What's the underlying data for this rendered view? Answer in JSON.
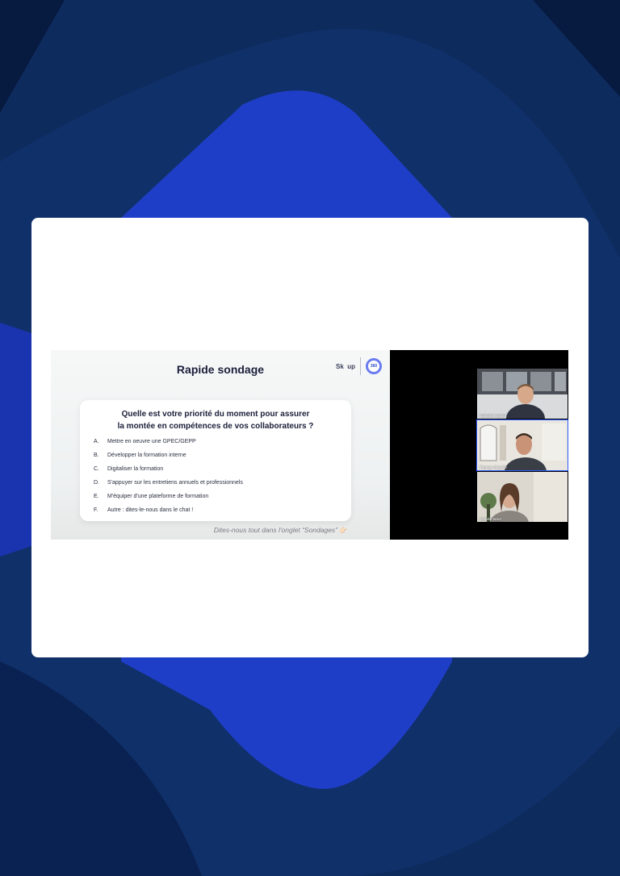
{
  "slide": {
    "title": "Rapide sondage",
    "brand_name": "Sk  up",
    "brand_badge": "360",
    "question_line1": "Quelle est votre priorité du moment pour assurer",
    "question_line2": "la montée en compétences de vos collaborateurs ?",
    "options": [
      {
        "letter": "A.",
        "text": "Mettre en oeuvre une GPEC/GEPP"
      },
      {
        "letter": "B.",
        "text": "Développer la formation interne"
      },
      {
        "letter": "C.",
        "text": "Digitaliser la formation"
      },
      {
        "letter": "D.",
        "text": "S'appuyer sur les entretiens annuels et professionnels"
      },
      {
        "letter": "E.",
        "text": "M'équiper d'une plateforme de formation"
      },
      {
        "letter": "F.",
        "text": "Autre : dites-le-nous dans le chat !"
      }
    ],
    "footer": "Dites-nous tout dans l'onglet “Sondages”",
    "footer_icon": "👉🏻"
  },
  "participants": [
    {
      "name": "Colombe Sachot",
      "active": false
    },
    {
      "name": "Thomas Toucalle",
      "active": true
    },
    {
      "name": "Camille Ward",
      "active": false
    }
  ],
  "colors": {
    "background": "#0a1f4a",
    "shape_blue": "#1f3ec8",
    "active_border": "#2d5bff"
  }
}
